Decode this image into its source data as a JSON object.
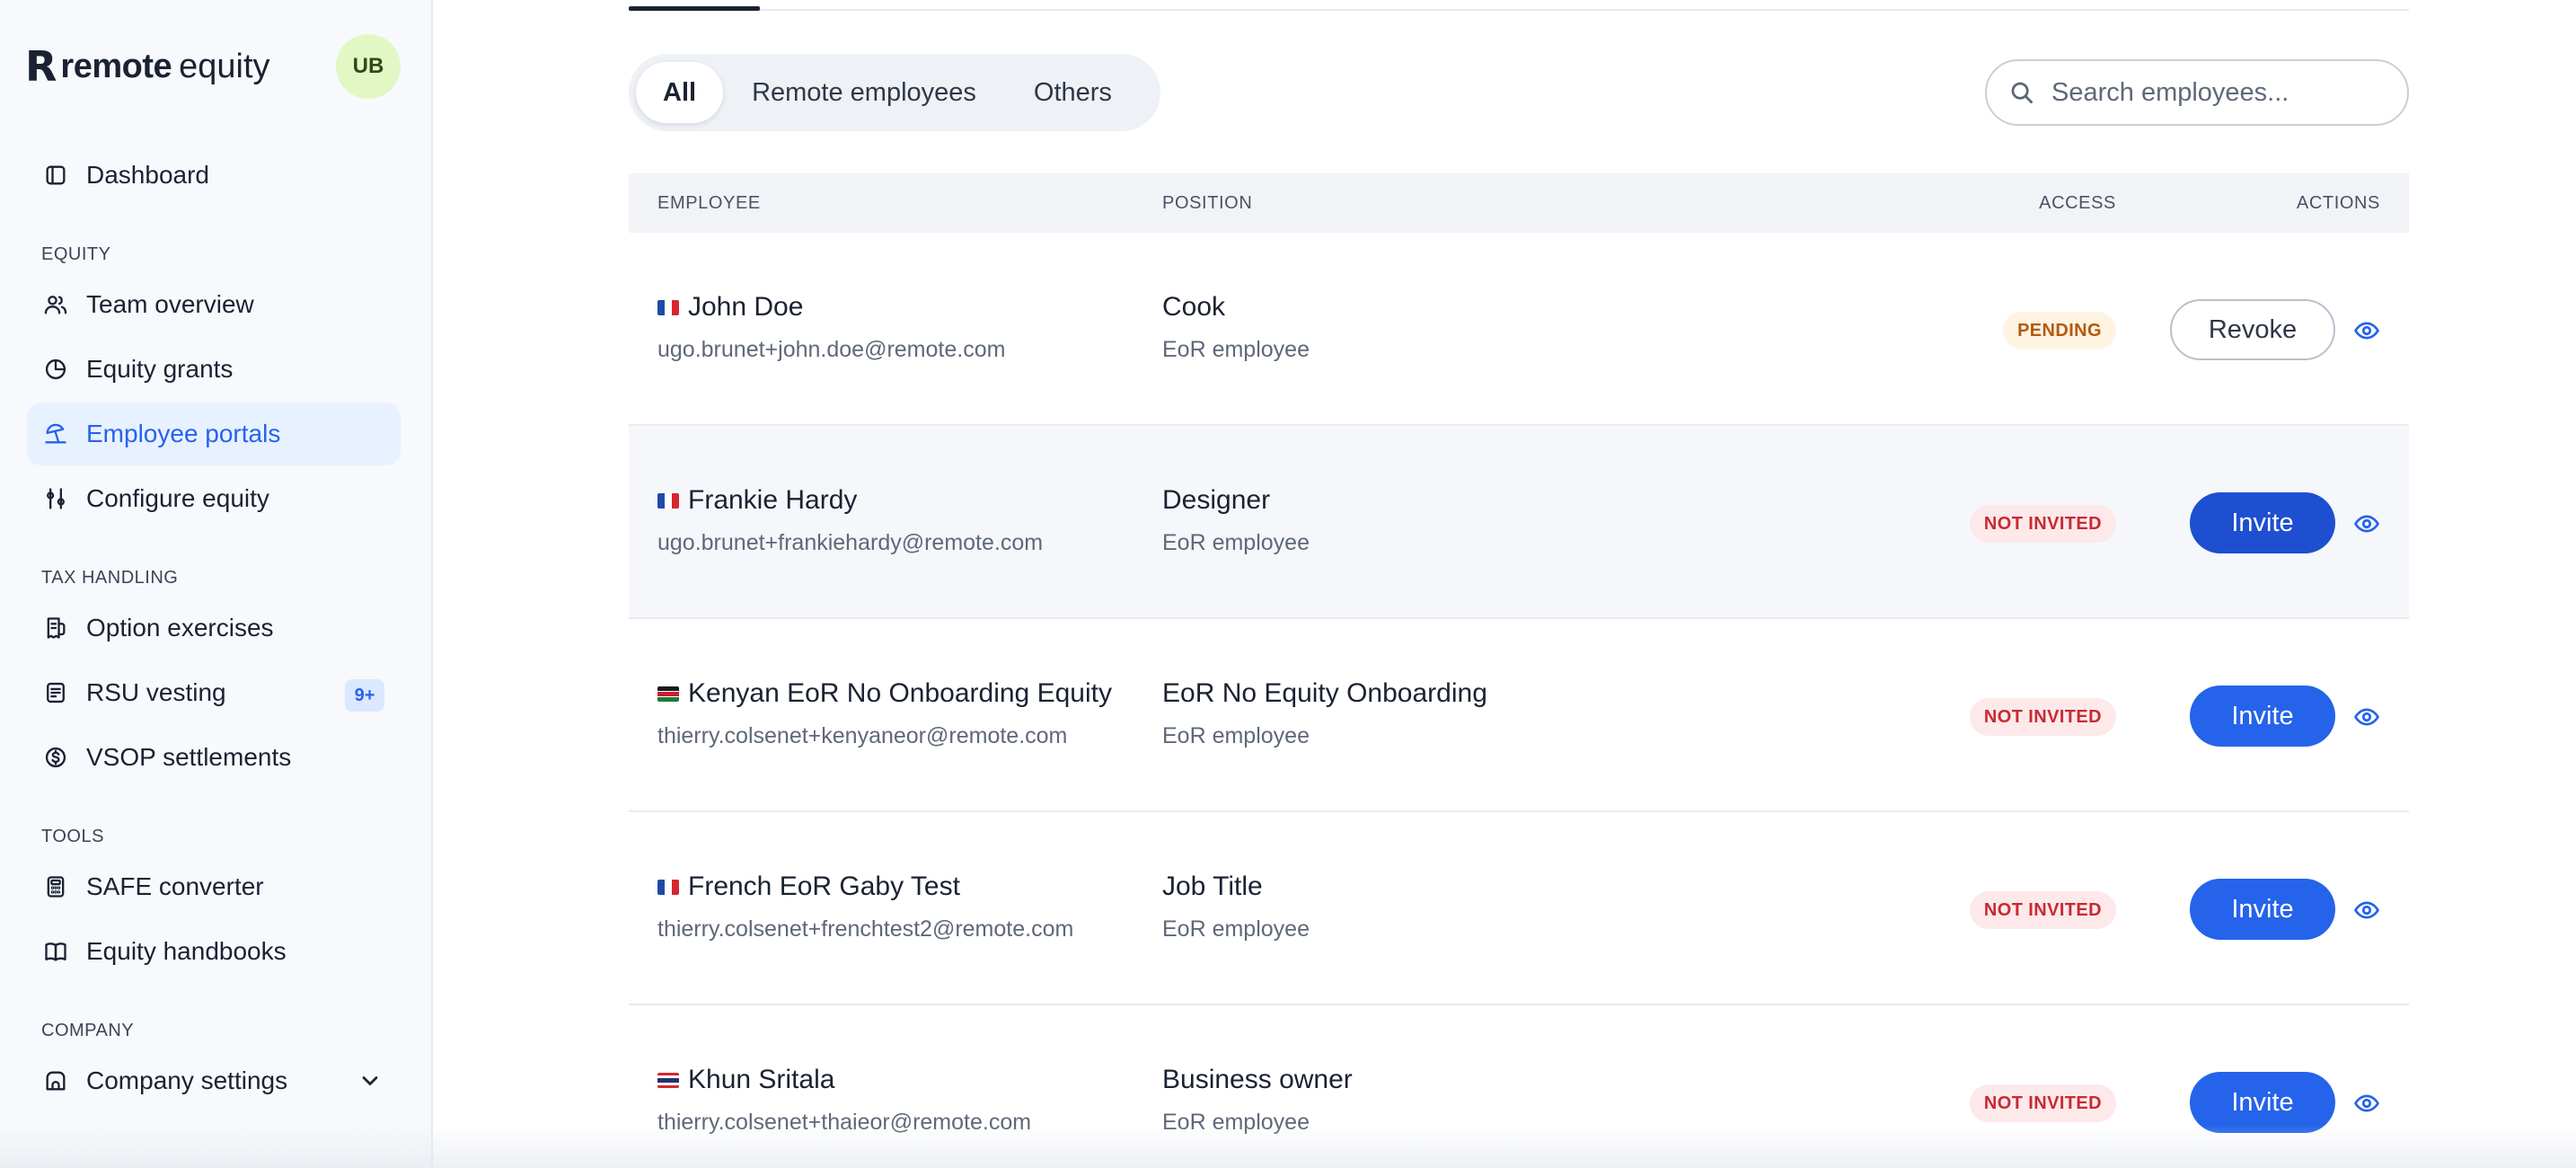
{
  "brand": {
    "mark": "R",
    "name_bold": "remote",
    "name_light": "equity"
  },
  "user": {
    "initials": "UB"
  },
  "sidebar": {
    "dashboard": {
      "label": "Dashboard",
      "icon": "layout-icon"
    },
    "sections": [
      {
        "label": "EQUITY",
        "items": [
          {
            "label": "Team overview",
            "icon": "users-icon"
          },
          {
            "label": "Equity grants",
            "icon": "pie-chart-icon"
          },
          {
            "label": "Employee portals",
            "icon": "umbrella-beach-icon",
            "active": true
          },
          {
            "label": "Configure equity",
            "icon": "sliders-icon"
          }
        ]
      },
      {
        "label": "TAX HANDLING",
        "items": [
          {
            "label": "Option exercises",
            "icon": "receipt-icon"
          },
          {
            "label": "RSU vesting",
            "icon": "document-icon",
            "badge": "9+"
          },
          {
            "label": "VSOP settlements",
            "icon": "dollar-circle-icon"
          }
        ]
      },
      {
        "label": "TOOLS",
        "items": [
          {
            "label": "SAFE converter",
            "icon": "calculator-icon"
          },
          {
            "label": "Equity handbooks",
            "icon": "book-icon"
          }
        ]
      },
      {
        "label": "COMPANY",
        "items": [
          {
            "label": "Company settings",
            "icon": "building-icon",
            "expandable": true
          }
        ]
      }
    ]
  },
  "filters": {
    "options": [
      "All",
      "Remote employees",
      "Others"
    ],
    "selected": "All"
  },
  "search": {
    "placeholder": "Search employees...",
    "value": ""
  },
  "table": {
    "columns": {
      "employee": "EMPLOYEE",
      "position": "POSITION",
      "access": "ACCESS",
      "actions": "ACTIONS"
    },
    "rows": [
      {
        "flag": "france",
        "name": "John Doe",
        "email": "ugo.brunet+john.doe@remote.com",
        "position": "Cook",
        "type": "EoR employee",
        "access": "PENDING",
        "action": "Revoke"
      },
      {
        "flag": "france",
        "name": "Frankie Hardy",
        "email": "ugo.brunet+frankiehardy@remote.com",
        "position": "Designer",
        "type": "EoR employee",
        "access": "NOT INVITED",
        "action": "Invite"
      },
      {
        "flag": "kenya",
        "name": "Kenyan EoR No Onboarding Equity",
        "email": "thierry.colsenet+kenyaneor@remote.com",
        "position": "EoR No Equity Onboarding",
        "type": "EoR employee",
        "access": "NOT INVITED",
        "action": "Invite"
      },
      {
        "flag": "france",
        "name": "French EoR Gaby Test",
        "email": "thierry.colsenet+frenchtest2@remote.com",
        "position": "Job Title",
        "type": "EoR employee",
        "access": "NOT INVITED",
        "action": "Invite"
      },
      {
        "flag": "thailand",
        "name": "Khun Sritala",
        "email": "thierry.colsenet+thaieor@remote.com",
        "position": "Business owner",
        "type": "EoR employee",
        "access": "NOT INVITED",
        "action": "Invite"
      }
    ]
  },
  "colors": {
    "accent": "#2563eb",
    "pending": "#b4590a",
    "not_invited": "#c62a34"
  }
}
